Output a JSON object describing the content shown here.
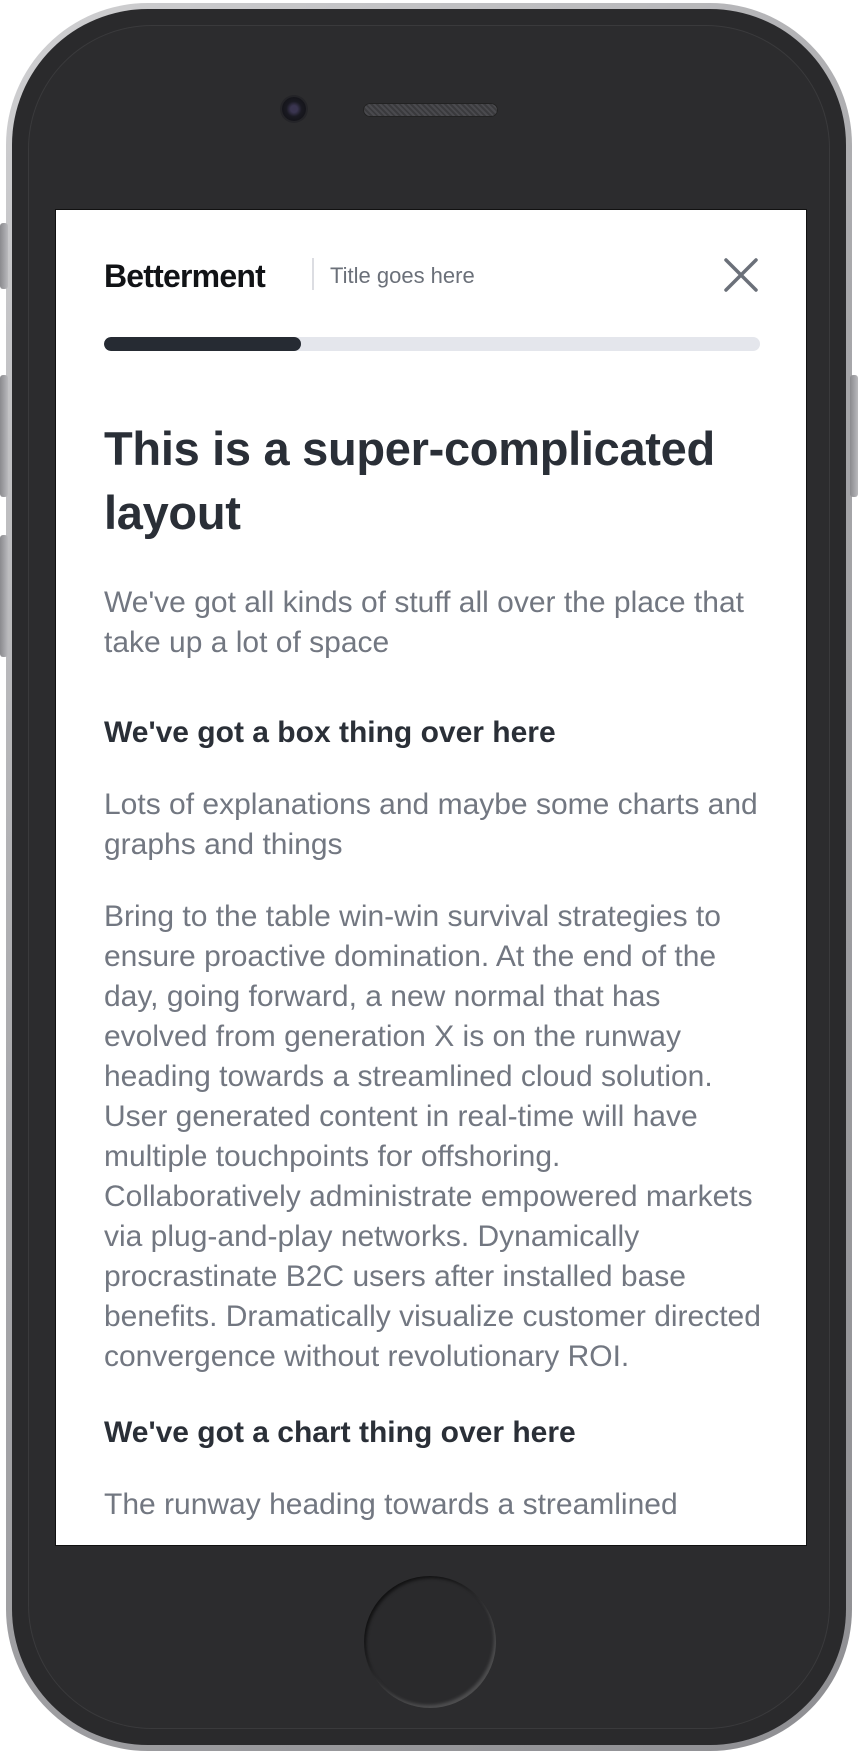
{
  "header": {
    "brand": "Betterment",
    "title": "Title goes here"
  },
  "progress": {
    "value_percent": 30
  },
  "colors": {
    "progress_fill": "#262b33",
    "progress_track": "#e4e6ec",
    "heading": "#2a2f37",
    "body_text": "#727781"
  },
  "icons": {
    "close": "close-icon"
  },
  "main": {
    "title": "This is a super-complicated layout",
    "subtitle": "We've got all kinds of stuff all over the place that take up a lot of space",
    "section1_heading": "We've got a box thing over here",
    "section1_intro": "Lots of explanations and maybe some charts and graphs and things",
    "section1_body": "Bring to the table win-win survival strategies to ensure proactive domination. At the end of the day, going forward, a new normal that has evolved from generation X is on the runway heading towards a streamlined cloud solution. User generated content in real-time will have multiple touchpoints for offshoring. Collaboratively administrate empowered markets via plug-and-play networks. Dynamically procrastinate B2C users after installed base benefits. Dramatically visualize customer directed convergence without revolutionary ROI.",
    "section2_heading": "We've got a chart thing over here",
    "section2_body": "The runway heading towards a streamlined"
  }
}
